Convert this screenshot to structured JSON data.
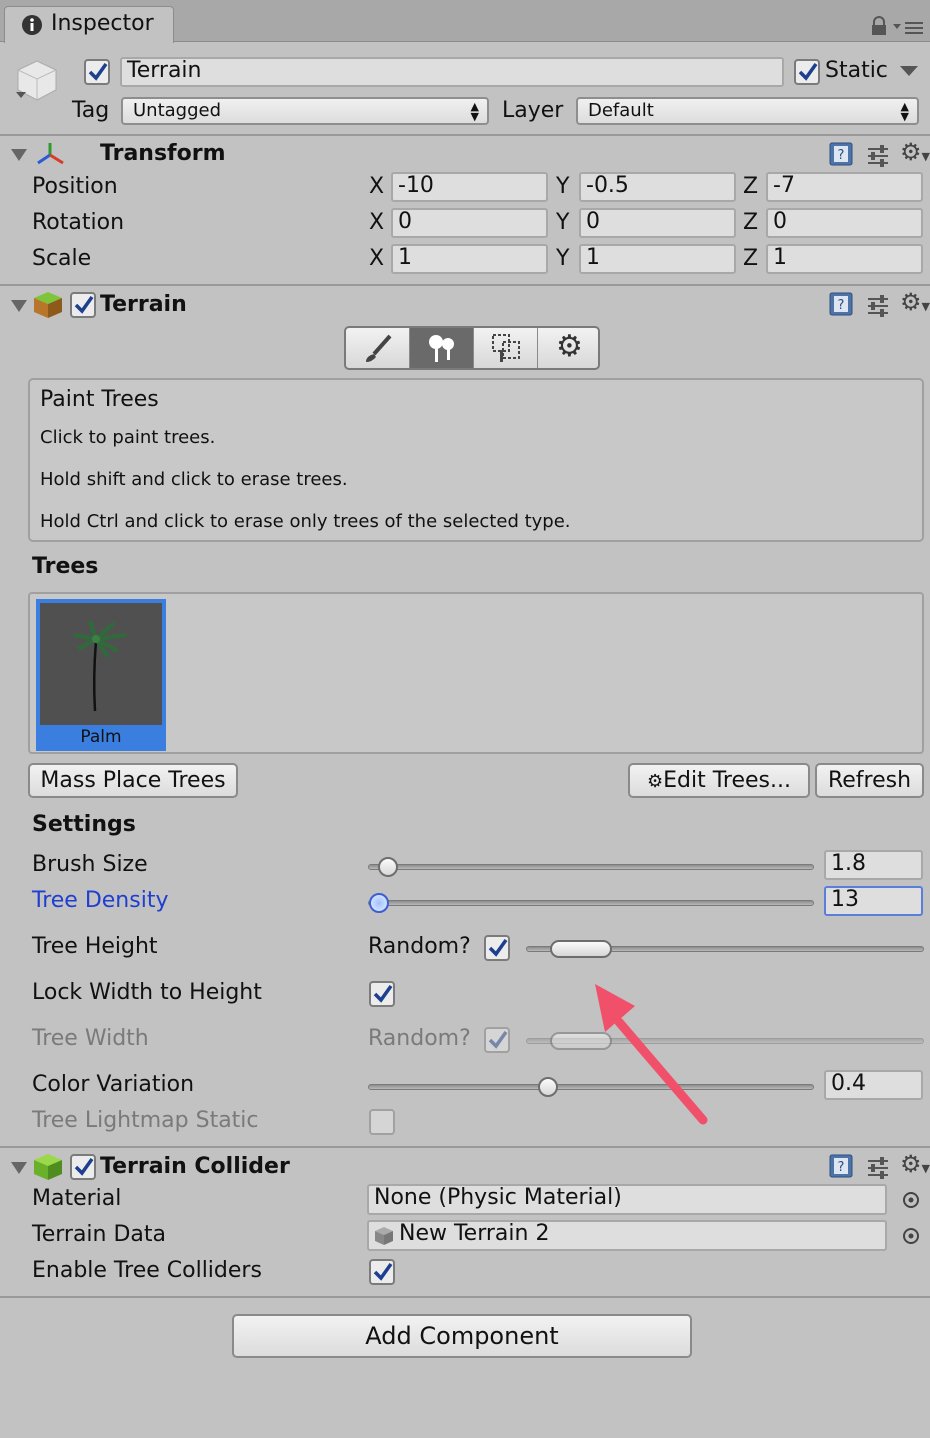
{
  "tab": {
    "label": "Inspector",
    "info_icon": "info-icon",
    "lock_icon": "lock-icon",
    "menu_icon": "menu-icon"
  },
  "object": {
    "name": "Terrain",
    "active": true,
    "static_label": "Static",
    "static": true,
    "tag_label": "Tag",
    "tag_value": "Untagged",
    "layer_label": "Layer",
    "layer_value": "Default"
  },
  "transform": {
    "title": "Transform",
    "rows": [
      {
        "label": "Position",
        "x": "-10",
        "y": "-0.5",
        "z": "-7"
      },
      {
        "label": "Rotation",
        "x": "0",
        "y": "0",
        "z": "0"
      },
      {
        "label": "Scale",
        "x": "1",
        "y": "1",
        "z": "1"
      }
    ],
    "axes": {
      "x": "X",
      "y": "Y",
      "z": "Z"
    }
  },
  "terrain": {
    "title": "Terrain",
    "enabled": true,
    "tools": [
      "paint-brush-icon",
      "paint-trees-icon",
      "paint-details-icon",
      "settings-gear-icon"
    ],
    "active_tool": 1,
    "help": {
      "title": "Paint Trees",
      "line1": "Click to paint trees.",
      "line2": "Hold shift and click to erase trees.",
      "line3": "Hold Ctrl and click to erase only trees of the selected type."
    },
    "trees_header": "Trees",
    "tree_item": "Palm",
    "buttons": {
      "mass_place": "Mass Place Trees",
      "edit_trees": "Edit Trees...",
      "refresh": "Refresh"
    },
    "settings_header": "Settings",
    "brush_size": {
      "label": "Brush Size",
      "value": "1.8",
      "fraction": 0.04
    },
    "tree_density": {
      "label": "Tree Density",
      "value": "13",
      "fraction": 0.02
    },
    "tree_height": {
      "label": "Tree Height",
      "random_label": "Random?",
      "random": true
    },
    "lock_width": {
      "label": "Lock Width to Height",
      "checked": true
    },
    "tree_width": {
      "label": "Tree Width",
      "random_label": "Random?",
      "random": true
    },
    "color_variation": {
      "label": "Color Variation",
      "value": "0.4",
      "fraction": 0.4
    },
    "lightmap_static": {
      "label": "Tree Lightmap Static",
      "checked": false
    }
  },
  "collider": {
    "title": "Terrain Collider",
    "enabled": true,
    "material_label": "Material",
    "material_value": "None (Physic Material)",
    "terrain_data_label": "Terrain Data",
    "terrain_data_value": "New Terrain 2",
    "tree_colliders_label": "Enable Tree Colliders",
    "tree_colliders": true
  },
  "add_component": "Add Component",
  "colors": {
    "accent_blue": "#1f3fd1",
    "selection_blue": "#3a7fe0",
    "annotation_red": "#f0506a"
  }
}
